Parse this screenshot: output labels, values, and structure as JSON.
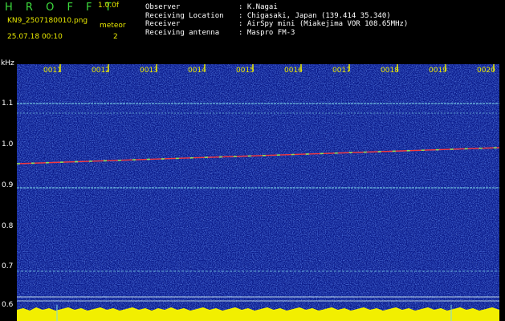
{
  "header": {
    "app_title": "H R O F F T",
    "version": "1.0.0f",
    "file_name": "KN9_2507180010.png",
    "meteor_label": "meteor",
    "meteor_count": "2",
    "datetime": "25.07.18 00:10"
  },
  "info": [
    {
      "label": "Observer",
      "value": "K.Nagai"
    },
    {
      "label": "Receiving Location",
      "value": "Chigasaki, Japan (139.414 35.340)"
    },
    {
      "label": "Receiver",
      "value": "AirSpy mini (Miakejima VOR 108.65MHz)"
    },
    {
      "label": "Receiving antenna",
      "value": "Maspro FM-3"
    }
  ],
  "y_axis": {
    "unit": "kHz",
    "ticks": [
      "1.1",
      "1.0",
      "0.9",
      "0.8",
      "0.7",
      "0.6"
    ]
  },
  "x_axis": {
    "ticks": [
      "0011",
      "0012",
      "0013",
      "0014",
      "0015",
      "0016",
      "0017",
      "0018",
      "0019",
      "0020"
    ]
  },
  "colors": {
    "background": "#000000",
    "noise_blue": "#1a2fc0",
    "title_green": "#3ddc3d",
    "label_yellow": "#e8e800",
    "floor_yellow": "#f2ef00"
  }
}
